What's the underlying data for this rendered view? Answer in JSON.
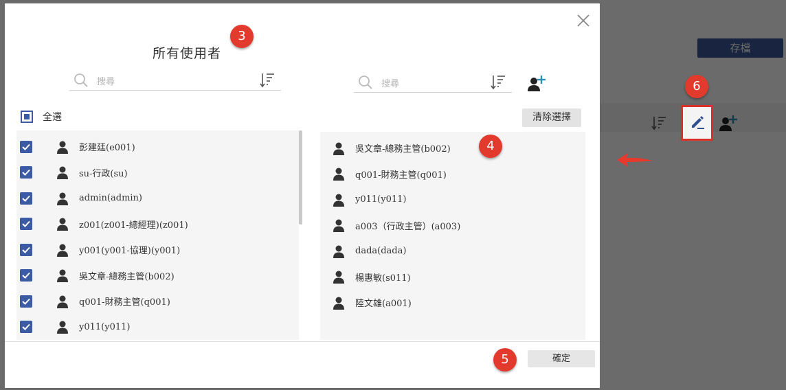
{
  "background": {
    "save_label": "存檔"
  },
  "modal": {
    "title": "所有使用者",
    "left_search_placeholder": "搜尋",
    "right_search_placeholder": "搜尋",
    "select_all_label": "全選",
    "clear_label": "清除選擇",
    "confirm_label": "確定",
    "left_users": [
      {
        "name": "彭建廷(e001)",
        "checked": true
      },
      {
        "name": "su-行政(su)",
        "checked": true
      },
      {
        "name": "admin(admin)",
        "checked": true
      },
      {
        "name": "z001(z001-總經理)(z001)",
        "checked": true
      },
      {
        "name": "y001(y001-協理)(y001)",
        "checked": true
      },
      {
        "name": "吳文章-總務主管(b002)",
        "checked": true
      },
      {
        "name": "q001-財務主管(q001)",
        "checked": true
      },
      {
        "name": "y011(y011)",
        "checked": true
      }
    ],
    "right_users": [
      {
        "name": "吳文章-總務主管(b002)"
      },
      {
        "name": "q001-財務主管(q001)"
      },
      {
        "name": "y011(y011)"
      },
      {
        "name": "a003（行政主管）(a003)"
      },
      {
        "name": "dada(dada)"
      },
      {
        "name": "楊惠敏(s011)"
      },
      {
        "name": "陸文雄(a001)"
      }
    ]
  },
  "badges": [
    "3",
    "4",
    "5",
    "6"
  ],
  "colors": {
    "accent": "#3b5ba5",
    "badge": "#e23b2e",
    "highlight_border": "#d9302a",
    "add_user_plus": "#2a8fb5"
  },
  "icons": {
    "close": "close-icon",
    "search": "search-icon",
    "sort": "sort-icon",
    "add_user": "add-user-icon",
    "person": "person-icon",
    "edit": "pencil-icon",
    "checkbox": "check-icon",
    "arrow": "arrow-left-icon"
  }
}
